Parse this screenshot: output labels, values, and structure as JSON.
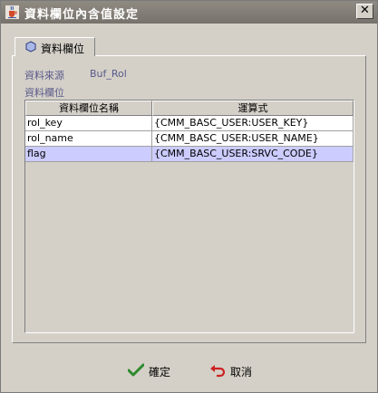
{
  "window": {
    "title": "資料欄位內含值設定",
    "close_glyph": "✕"
  },
  "tab": {
    "label": "資料欄位"
  },
  "form": {
    "source_label": "資料來源",
    "source_value": "Buf_Rol",
    "fields_label": "資料欄位"
  },
  "table": {
    "columns": [
      "資料欄位名稱",
      "運算式"
    ],
    "rows": [
      {
        "name": "rol_key",
        "expr": "{CMM_BASC_USER:USER_KEY}"
      },
      {
        "name": "rol_name",
        "expr": "{CMM_BASC_USER:USER_NAME}"
      },
      {
        "name": "flag",
        "expr": "{CMM_BASC_USER:SRVC_CODE}"
      }
    ],
    "selected_row": 2
  },
  "buttons": {
    "ok": "確定",
    "cancel": "取消"
  },
  "colors": {
    "selection": "#ccccff",
    "label_text": "#5a5a8c",
    "ok_icon": "#2e8b2e",
    "cancel_icon": "#cc2222"
  }
}
